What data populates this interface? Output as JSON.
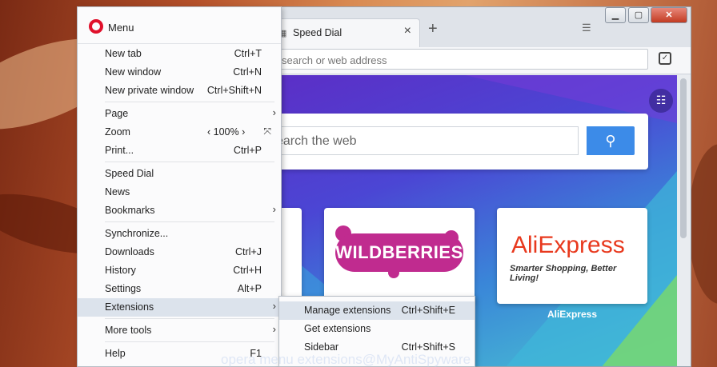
{
  "browser": {
    "tab_title": "Speed Dial",
    "tab_favicon": "grid-icon",
    "close_tab": "×",
    "new_tab": "+",
    "address_placeholder": "search or web address",
    "window_buttons": {
      "minimize": "▁",
      "maximize": "▢",
      "close": "✕"
    }
  },
  "speed_dial": {
    "search_placeholder": "earch the web",
    "tiles": [
      {
        "name": "WILDBERRIES",
        "caption": ""
      },
      {
        "name": "AliExpress",
        "subtitle": "Smarter Shopping, Better Living!",
        "caption": "AliExpress"
      }
    ]
  },
  "menu": {
    "title": "Menu",
    "items": [
      {
        "label": "New tab",
        "shortcut": "Ctrl+T"
      },
      {
        "label": "New window",
        "shortcut": "Ctrl+N"
      },
      {
        "label": "New private window",
        "shortcut": "Ctrl+Shift+N"
      },
      {
        "label": "Page",
        "arrow": "›"
      },
      {
        "label": "Zoom",
        "zoom": "‹ 100% ›",
        "fullscreen": "⤧"
      },
      {
        "label": "Print...",
        "shortcut": "Ctrl+P"
      },
      {
        "label": "Speed Dial"
      },
      {
        "label": "News"
      },
      {
        "label": "Bookmarks",
        "arrow": "›"
      },
      {
        "label": "Synchronize..."
      },
      {
        "label": "Downloads",
        "shortcut": "Ctrl+J"
      },
      {
        "label": "History",
        "shortcut": "Ctrl+H"
      },
      {
        "label": "Settings",
        "shortcut": "Alt+P"
      },
      {
        "label": "Extensions",
        "arrow": "›"
      },
      {
        "label": "More tools",
        "arrow": "›"
      },
      {
        "label": "Help",
        "shortcut": "F1"
      }
    ]
  },
  "extensions_submenu": {
    "items": [
      {
        "label": "Manage extensions",
        "shortcut": "Ctrl+Shift+E"
      },
      {
        "label": "Get extensions"
      },
      {
        "label": "Sidebar",
        "shortcut": "Ctrl+Shift+S"
      }
    ]
  },
  "watermark": "opera menu extensions@MyAntiSpyware",
  "colors": {
    "opera_red": "#e0102b",
    "search_button": "#3c8be8",
    "highlight": "#dce3ec"
  }
}
